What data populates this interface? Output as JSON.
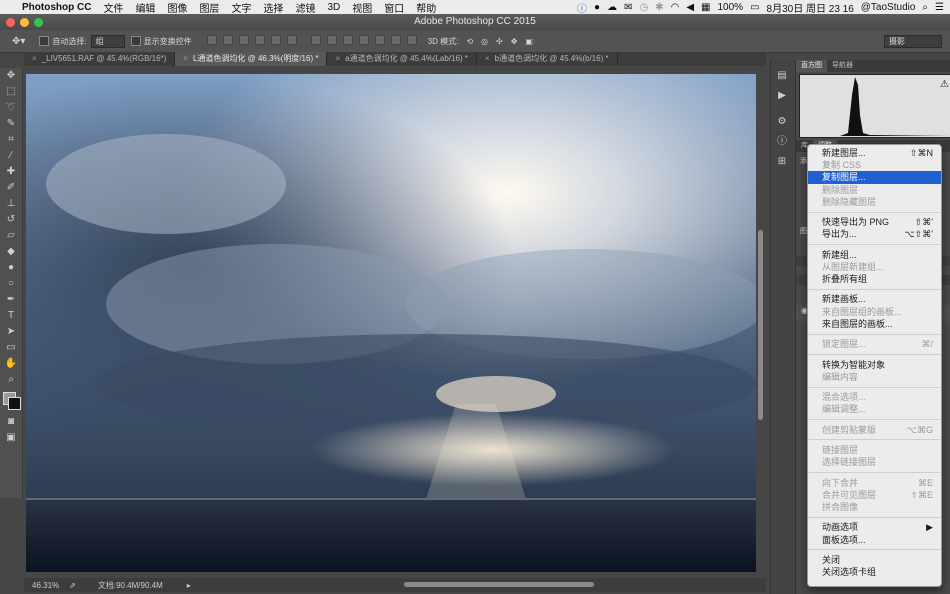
{
  "menubar": {
    "app_name": "Photoshop CC",
    "menus": [
      "文件",
      "编辑",
      "图像",
      "图层",
      "文字",
      "选择",
      "滤镜",
      "3D",
      "视图",
      "窗口",
      "帮助"
    ],
    "battery": "100%",
    "datetime": "8月30日 周日  23 16",
    "user": "@TaoStudio"
  },
  "window": {
    "title": "Adobe Photoshop CC 2015"
  },
  "options_bar": {
    "auto_select_label": "自动选择:",
    "auto_select_value": "组",
    "show_transform_label": "显示变换控件",
    "mode_3d_label": "3D 模式:",
    "workspace": "摄影"
  },
  "tabs": [
    {
      "label": "_LIV5651.RAF @ 45.4%(RGB/16*)"
    },
    {
      "label": "L通道色调均化 @ 46.3%(明度/16) *"
    },
    {
      "label": "a通道色调均化 @ 45.4%(Lab/16) *"
    },
    {
      "label": "b通道色调均化 @ 45.4%(b/16) *"
    }
  ],
  "status": {
    "zoom": "46.31%",
    "doc_info": "文档:90.4M/90.4M"
  },
  "panels": {
    "top_tabs": [
      "直方图",
      "导航器"
    ],
    "side_labels": [
      "库",
      "调整",
      "图",
      "添"
    ]
  },
  "context_menu": {
    "groups": [
      [
        {
          "label": "新建图层...",
          "shortcut": "⇧⌘N",
          "enabled": true
        },
        {
          "label": "复制 CSS",
          "shortcut": "",
          "enabled": false
        },
        {
          "label": "复制图层...",
          "shortcut": "",
          "enabled": true,
          "highlighted": true
        },
        {
          "label": "删除图层",
          "shortcut": "",
          "enabled": false
        },
        {
          "label": "删除隐藏图层",
          "shortcut": "",
          "enabled": false
        }
      ],
      [
        {
          "label": "快速导出为 PNG",
          "shortcut": "⇧⌘'",
          "enabled": true
        },
        {
          "label": "导出为...",
          "shortcut": "⌥⇧⌘'",
          "enabled": true
        }
      ],
      [
        {
          "label": "新建组...",
          "shortcut": "",
          "enabled": true
        },
        {
          "label": "从图层新建组...",
          "shortcut": "",
          "enabled": false
        },
        {
          "label": "折叠所有组",
          "shortcut": "",
          "enabled": true
        }
      ],
      [
        {
          "label": "新建画板...",
          "shortcut": "",
          "enabled": true
        },
        {
          "label": "来自图层组的画板...",
          "shortcut": "",
          "enabled": false
        },
        {
          "label": "来自图层的画板...",
          "shortcut": "",
          "enabled": true
        }
      ],
      [
        {
          "label": "锁定图层...",
          "shortcut": "⌘/",
          "enabled": false
        }
      ],
      [
        {
          "label": "转换为智能对象",
          "shortcut": "",
          "enabled": true
        },
        {
          "label": "编辑内容",
          "shortcut": "",
          "enabled": false
        }
      ],
      [
        {
          "label": "混合选项...",
          "shortcut": "",
          "enabled": false
        },
        {
          "label": "编辑调整...",
          "shortcut": "",
          "enabled": false
        }
      ],
      [
        {
          "label": "创建剪贴蒙版",
          "shortcut": "⌥⌘G",
          "enabled": false
        }
      ],
      [
        {
          "label": "链接图层",
          "shortcut": "",
          "enabled": false
        },
        {
          "label": "选择链接图层",
          "shortcut": "",
          "enabled": false
        }
      ],
      [
        {
          "label": "向下合并",
          "shortcut": "⌘E",
          "enabled": false
        },
        {
          "label": "合并可见图层",
          "shortcut": "⇧⌘E",
          "enabled": false
        },
        {
          "label": "拼合图像",
          "shortcut": "",
          "enabled": false
        }
      ],
      [
        {
          "label": "动画选项",
          "shortcut": "▶",
          "enabled": true
        },
        {
          "label": "面板选项...",
          "shortcut": "",
          "enabled": true
        }
      ],
      [
        {
          "label": "关闭",
          "shortcut": "",
          "enabled": true
        },
        {
          "label": "关闭选项卡组",
          "shortcut": "",
          "enabled": true
        }
      ]
    ]
  }
}
